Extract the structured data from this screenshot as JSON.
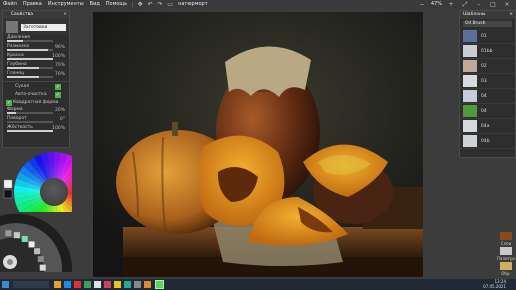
{
  "menu": {
    "items": [
      "Файл",
      "Правка",
      "Инструменты",
      "Вид",
      "Помощь"
    ],
    "right_readout": "47%",
    "doc_name": "натюрморт"
  },
  "properties_panel": {
    "title": "Свойства",
    "brush_dropdown": "Заготовки",
    "sliders": [
      {
        "label": "Давление",
        "value": "",
        "level": 0.35
      },
      {
        "label": "Размазка",
        "value": "96%",
        "level": 0.9
      },
      {
        "label": "Краска",
        "value": "100%",
        "level": 1.0
      },
      {
        "label": "Глубина",
        "value": "70%",
        "level": 0.7
      },
      {
        "label": "Глянец",
        "value": "70%",
        "level": 0.7
      }
    ],
    "checks": [
      {
        "label": "Сухая",
        "checked": true
      },
      {
        "label": "Авто-очистка",
        "checked": true
      },
      {
        "label": "Квадратная форма",
        "checked": true
      }
    ],
    "sliders2": [
      {
        "label": "Форма",
        "value": "20%",
        "level": 0.2
      },
      {
        "label": "Поворот",
        "value": "0°",
        "level": 0.0
      },
      {
        "label": "Жёсткость",
        "value": "100%",
        "level": 1.0
      }
    ]
  },
  "presets_panel": {
    "title": "Шаблоны",
    "dropdown": "Oil Brush",
    "items": [
      {
        "name": "01",
        "color": "#5a6f9a"
      },
      {
        "name": "01bb",
        "color": "#c9cdd6"
      },
      {
        "name": "02",
        "color": "#bfa79a"
      },
      {
        "name": "03",
        "color": "#d6dbe0"
      },
      {
        "name": "04",
        "color": "#c3ccd8"
      },
      {
        "name": "04",
        "color": "#4e9a3c"
      },
      {
        "name": "04a",
        "color": "#d6d9de"
      },
      {
        "name": "04b",
        "color": "#cfd3d8"
      }
    ]
  },
  "right_tools": [
    {
      "label": "Слои",
      "color": "#8a4a1a"
    },
    {
      "label": "Палитра",
      "color": "#c9c9c9"
    },
    {
      "label": "Обр.",
      "color": "#d0b060"
    }
  ],
  "taskbar": {
    "time": "13:24",
    "date": "07.05.2021"
  }
}
